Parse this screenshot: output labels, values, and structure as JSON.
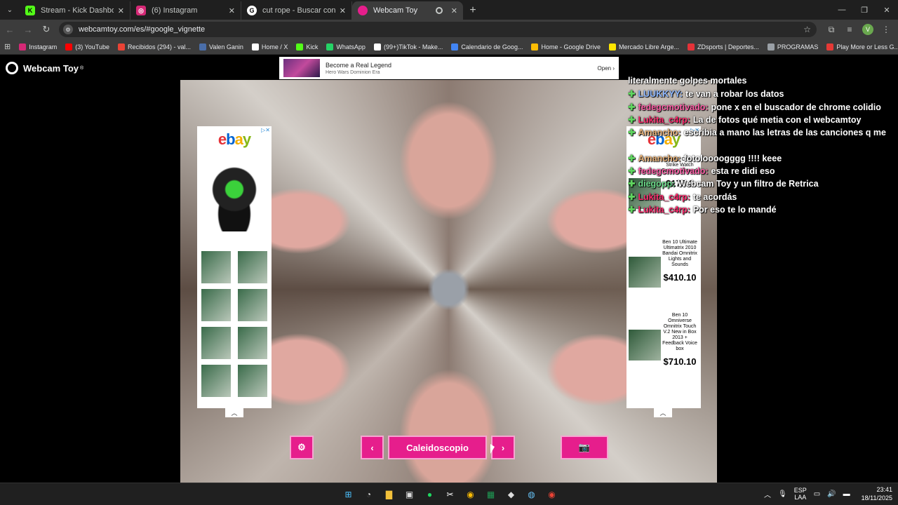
{
  "browser": {
    "tabs": [
      {
        "title": "Stream - Kick Dashboard",
        "active": false
      },
      {
        "title": "(6) Instagram",
        "active": false
      },
      {
        "title": "cut rope - Buscar con Google",
        "active": false
      },
      {
        "title": "Webcam Toy",
        "active": true
      }
    ],
    "url": "webcamtoy.com/es/#google_vignette",
    "avatar_letter": "V",
    "bookmarks": [
      {
        "label": "Instagram",
        "color": "#d62976"
      },
      {
        "label": "(3) YouTube",
        "color": "#ff0000"
      },
      {
        "label": "Recibidos (294) - val...",
        "color": "#ea4335"
      },
      {
        "label": "Valen Ganin",
        "color": "#4a6ea9"
      },
      {
        "label": "Home / X",
        "color": "#ffffff"
      },
      {
        "label": "Kick",
        "color": "#53fc18"
      },
      {
        "label": "WhatsApp",
        "color": "#25d366"
      },
      {
        "label": "(99+)TikTok - Make...",
        "color": "#ffffff"
      },
      {
        "label": "Calendario de Goog...",
        "color": "#4285f4"
      },
      {
        "label": "Home - Google Drive",
        "color": "#fbbc04"
      },
      {
        "label": "Mercado Libre Arge...",
        "color": "#ffe600"
      },
      {
        "label": "ZDsports | Deportes...",
        "color": "#e53238"
      },
      {
        "label": "PROGRAMAS",
        "color": "#9aa0a6"
      },
      {
        "label": "Play More or Less G...",
        "color": "#e53935"
      }
    ]
  },
  "site": {
    "brand": "Webcam Toy",
    "brand_mark": "®"
  },
  "top_ad": {
    "headline": "Become a Real Legend",
    "subline": "Hero Wars Dominion Era",
    "cta": "Open"
  },
  "right_ad": {
    "header": "Ben 10 Omni-Strike Watch Cartoon Network",
    "header_price": "$175.0",
    "products": [
      {
        "name": "Ben 10 Ultimate Ultimatrix 2010 Bandai Omnitrix Lights and Sounds",
        "price": "$410.10"
      },
      {
        "name": "Ben 10 Omniverse Omnitrix Touch V.2 New in Box 2013 + Feedback Voice box",
        "price": "$710.10"
      }
    ]
  },
  "controls": {
    "effect_label": "Caleidoscopio"
  },
  "chat": [
    {
      "user": "",
      "text": "literalmente golpes mortales",
      "user_color": "#ffffff"
    },
    {
      "user": "LUUKKYY:",
      "text": "te van a robar los datos",
      "user_color": "#8fb8ff"
    },
    {
      "user": "fedegcmotivado:",
      "text": "pone x en el buscador de chrome colidio",
      "user_color": "#ff5fa8"
    },
    {
      "user": "Lukita_c4rp:",
      "text": "La de fotos qué metia con el webcamtoy",
      "user_color": "#ff2d6f"
    },
    {
      "user": "Amancho:",
      "text": "escribia a mano las letras de las canciones q me",
      "user_color": "#e8b37a"
    },
    {
      "user": "",
      "text": "",
      "user_color": "#ffffff"
    },
    {
      "user": "Amancho:",
      "text": "fotoloooogggg !!!! keee",
      "user_color": "#e8b37a"
    },
    {
      "user": "fedegcmotivado:",
      "text": "esta re didi eso",
      "user_color": "#ff5fa8"
    },
    {
      "user": "diegopp:",
      "text": "Webcam Toy y un filtro de Retrica",
      "user_color": "#6ddc8b"
    },
    {
      "user": "Lukita_c4rp:",
      "text": "te acordás",
      "user_color": "#ff2d6f"
    },
    {
      "user": "Lukita_c4rp:",
      "text": "Por eso te lo mandé",
      "user_color": "#ff2d6f"
    }
  ],
  "taskbar": {
    "lang": "ESP",
    "lang_sub": "LAA",
    "time": "23:41",
    "date": "18/11/2025"
  }
}
